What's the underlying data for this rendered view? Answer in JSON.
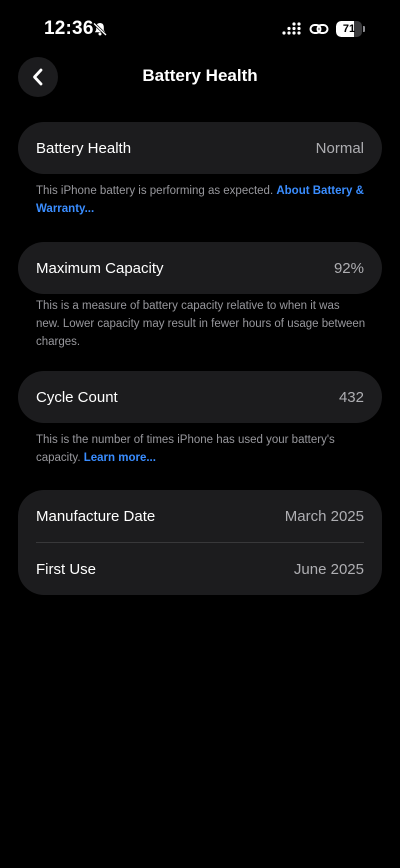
{
  "status_bar": {
    "time": "12:36",
    "battery_level": "71",
    "battery_fraction": 0.71
  },
  "nav": {
    "title": "Battery Health"
  },
  "health": {
    "label": "Battery Health",
    "value": "Normal",
    "footnote_text": "This iPhone battery is performing as expected. ",
    "footnote_link": "About Battery & Warranty..."
  },
  "capacity": {
    "label": "Maximum Capacity",
    "value": "92%",
    "footnote_text": "This is a measure of battery capacity relative to when it was new. Lower capacity may result in fewer hours of usage between charges."
  },
  "cycles": {
    "label": "Cycle Count",
    "value": "432",
    "footnote_text": "This is the number of times iPhone has used your battery's capacity. ",
    "footnote_link": "Learn more..."
  },
  "dates": {
    "manufacture_label": "Manufacture Date",
    "manufacture_value": "March 2025",
    "first_use_label": "First Use",
    "first_use_value": "June 2025"
  },
  "colors": {
    "background": "#000000",
    "card": "#1c1c1e",
    "link": "#3a8dff",
    "secondary_text": "#98989d"
  }
}
